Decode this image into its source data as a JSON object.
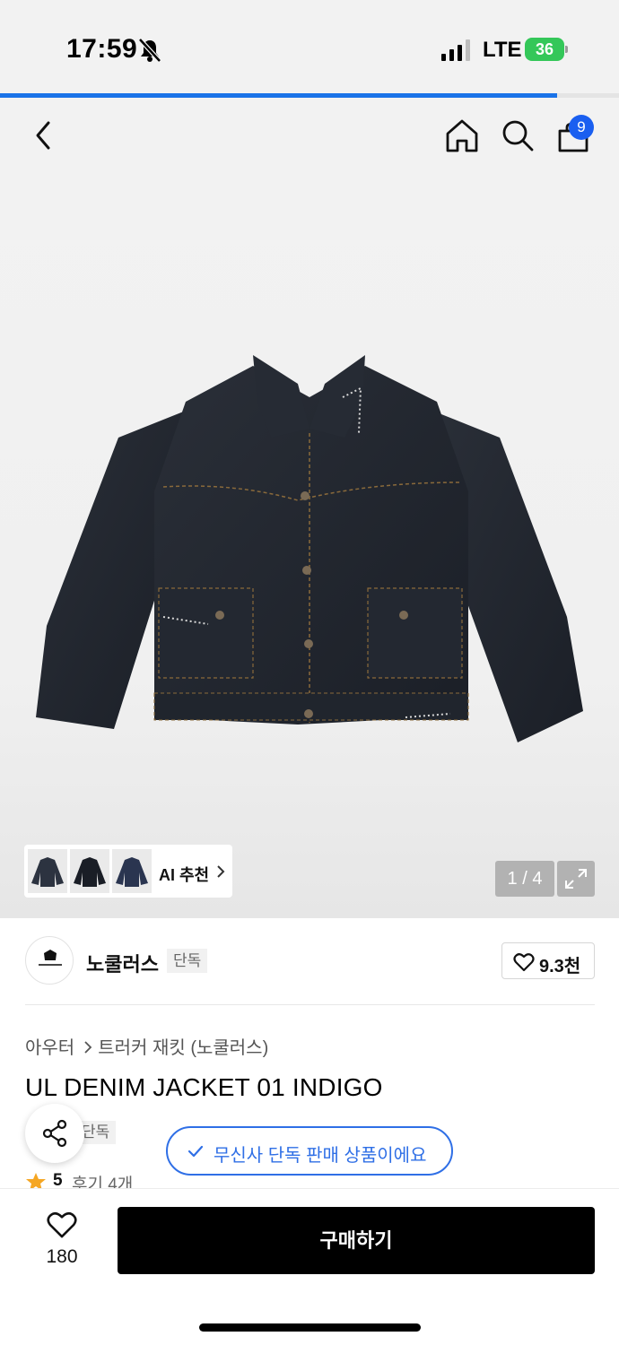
{
  "status_bar": {
    "time": "17:59",
    "network": "LTE",
    "battery": "36",
    "silent_icon": "bell-slash-icon",
    "signal_icon": "signal-bars-icon"
  },
  "page_load_progress": 0.9,
  "header": {
    "back_icon": "chevron-left-icon",
    "home_icon": "home-icon",
    "search_icon": "search-icon",
    "cart_icon": "shopping-bag-icon",
    "cart_count": "9"
  },
  "gallery": {
    "image": "navy-denim-jacket",
    "ai_recommend_label": "AI 추천",
    "counter": "1 / 4",
    "expand_icon": "expand-icon"
  },
  "brand": {
    "name": "노쿨러스",
    "exclusive_badge": "단독",
    "like_count": "9.3천"
  },
  "product": {
    "breadcrumb": [
      "아우터",
      "트러커 재킷 (노쿨러스)"
    ],
    "title": "UL DENIM JACKET 01 INDIGO",
    "exclusive_tag": "단독",
    "exclusive_banner": "무신사 단독 판매 상품이에요",
    "rating": "5",
    "review_label": "후기 4개"
  },
  "bottom_bar": {
    "like_count": "180",
    "buy_label": "구매하기"
  },
  "colors": {
    "accent_blue": "#2f6fe6",
    "badge_blue": "#1a5ff0",
    "star": "#f5a623",
    "battery": "#34c759"
  }
}
